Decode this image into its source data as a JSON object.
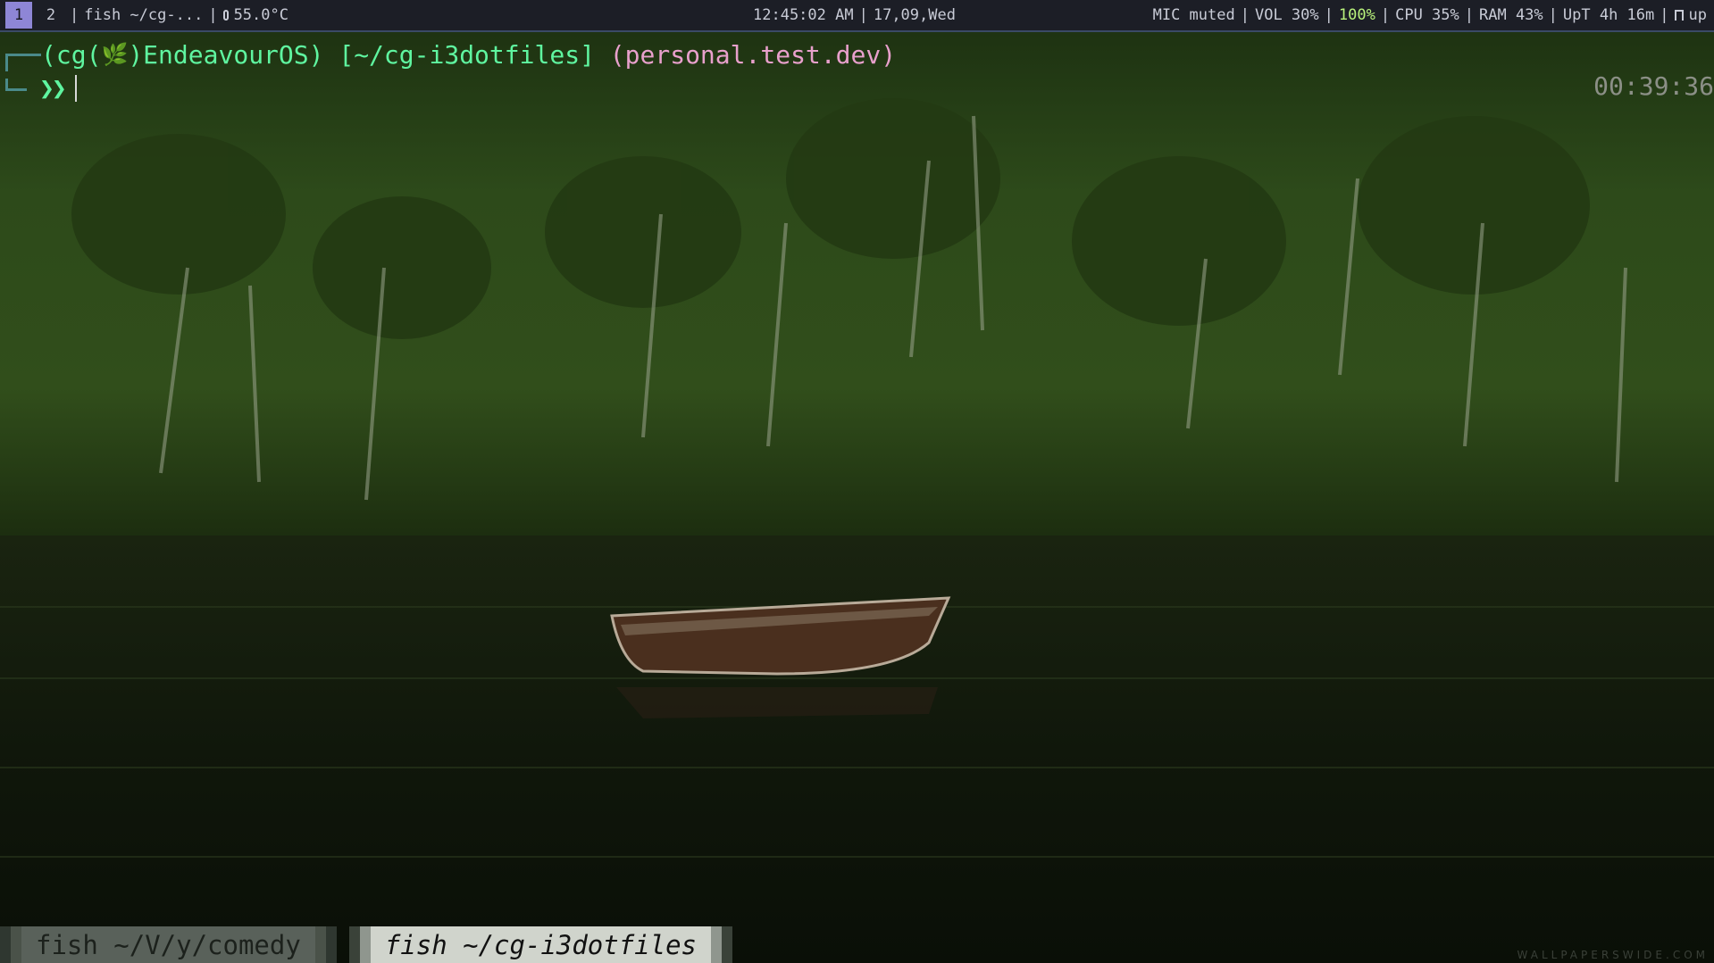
{
  "topbar": {
    "workspaces": [
      {
        "label": "1",
        "active": true
      },
      {
        "label": "2",
        "active": false
      }
    ],
    "window_title": "fish ~/cg-...",
    "temperature": "55.0°C",
    "clock": "12:45:02 AM",
    "date": "17,09,Wed",
    "mic": "MIC muted",
    "volume": "VOL 30%",
    "battery": "100%",
    "cpu": "CPU 35%",
    "ram": "RAM 43%",
    "uptime": "UpT 4h 16m",
    "updates": "up"
  },
  "terminal": {
    "user": "(cg(",
    "leaf_icon": "🌿",
    "host": ")EndeavourOS)",
    "path": "[~/cg-i3dotfiles]",
    "git_branch": "(personal.test.dev)",
    "prompt_symbol": "❯❯",
    "right_prompt_time": "00:39:36"
  },
  "tabs": [
    {
      "label": "fish ~/V/y/comedy",
      "active": false
    },
    {
      "label": "fish ~/cg-i3dotfiles",
      "active": true
    }
  ],
  "watermark": "WALLPAPERSWIDE.COM",
  "colors": {
    "topbar_bg": "#1c1e26",
    "workspace_active": "#8e86d6",
    "prompt_green": "#5ff5a0",
    "prompt_pink": "#e8a0cc",
    "battery_green": "#b9f27c"
  },
  "icons": [
    "thermometer-icon",
    "leaf-icon",
    "updates-icon"
  ]
}
